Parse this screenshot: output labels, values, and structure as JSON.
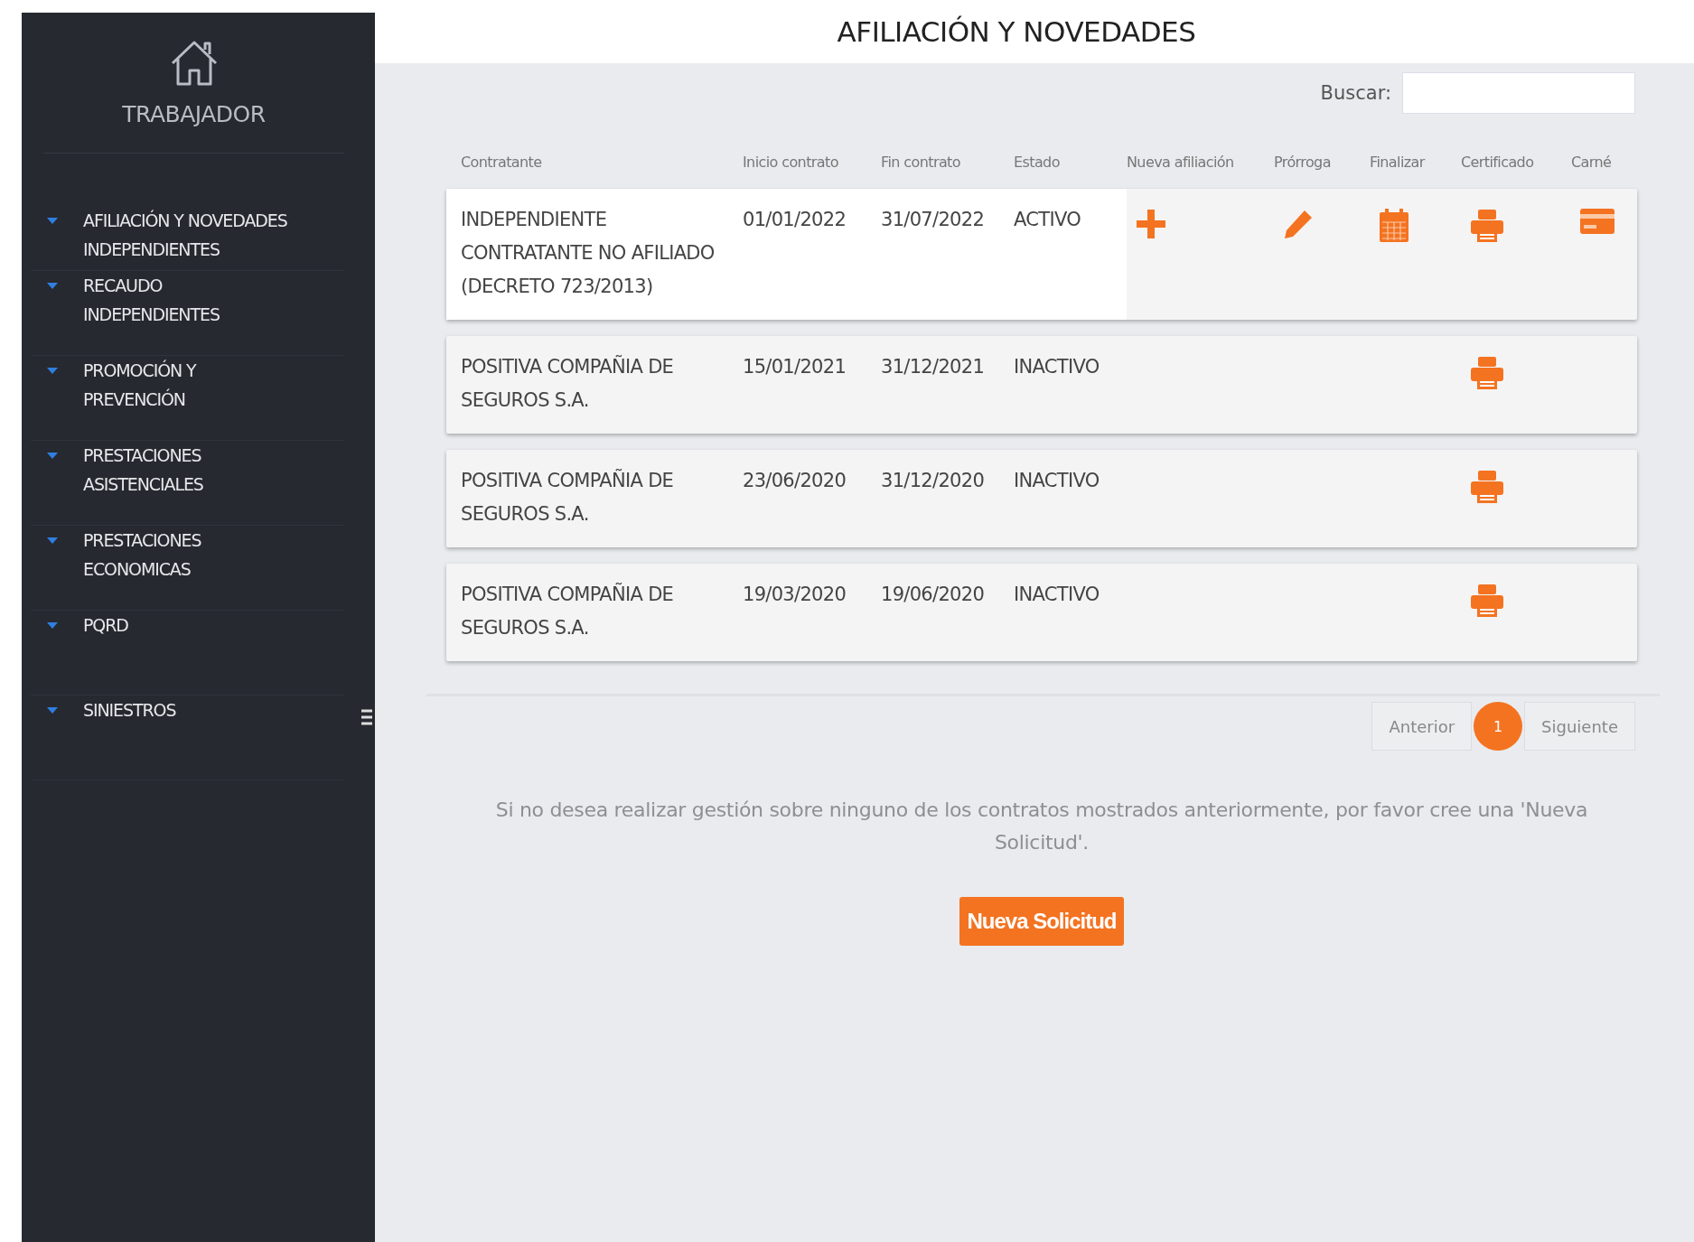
{
  "sidebar": {
    "title": "TRABAJADOR",
    "items": [
      {
        "label": "AFILIACIÓN Y NOVEDADES INDEPENDIENTES"
      },
      {
        "label": "RECAUDO INDEPENDIENTES"
      },
      {
        "label": "PROMOCIÓN Y PREVENCIÓN"
      },
      {
        "label": "PRESTACIONES ASISTENCIALES"
      },
      {
        "label": "PRESTACIONES ECONOMICAS"
      },
      {
        "label": "PQRD"
      },
      {
        "label": "SINIESTROS"
      }
    ]
  },
  "page_title": "AFILIACIÓN Y NOVEDADES",
  "search": {
    "label": "Buscar:"
  },
  "table": {
    "columns": [
      "Contratante",
      "Inicio contrato",
      "Fin contrato",
      "Estado",
      "Nueva afiliación",
      "Prórroga",
      "Finalizar",
      "Certificado",
      "Carné"
    ],
    "rows": [
      {
        "contratante": "INDEPENDIENTE CONTRATANTE NO AFILIADO (DECRETO 723/2013)",
        "inicio": "01/01/2022",
        "fin": "31/07/2022",
        "estado": "ACTIVO",
        "highlighted": true,
        "new_affiliation": true,
        "extension": true,
        "finalize": true,
        "certificate": true,
        "card": true
      },
      {
        "contratante": "POSITIVA COMPAÑIA DE SEGUROS S.A.",
        "inicio": "15/01/2021",
        "fin": "31/12/2021",
        "estado": "INACTIVO",
        "highlighted": false,
        "new_affiliation": false,
        "extension": false,
        "finalize": false,
        "certificate": true,
        "card": false
      },
      {
        "contratante": "POSITIVA COMPAÑIA DE SEGUROS S.A.",
        "inicio": "23/06/2020",
        "fin": "31/12/2020",
        "estado": "INACTIVO",
        "highlighted": false,
        "new_affiliation": false,
        "extension": false,
        "finalize": false,
        "certificate": true,
        "card": false
      },
      {
        "contratante": "POSITIVA COMPAÑIA DE SEGUROS S.A.",
        "inicio": "19/03/2020",
        "fin": "19/06/2020",
        "estado": "INACTIVO",
        "highlighted": false,
        "new_affiliation": false,
        "extension": false,
        "finalize": false,
        "certificate": true,
        "card": false
      }
    ]
  },
  "pagination": {
    "previous": "Anterior",
    "pages": [
      {
        "label": "1",
        "selected": true
      }
    ],
    "next": "Siguiente"
  },
  "notice": "Si no desea realizar gestión sobre ninguno de los contratos mostrados anteriormente, por favor cree una 'Nueva Solicitud'.",
  "new_request_button": "Nueva Solicitud"
}
